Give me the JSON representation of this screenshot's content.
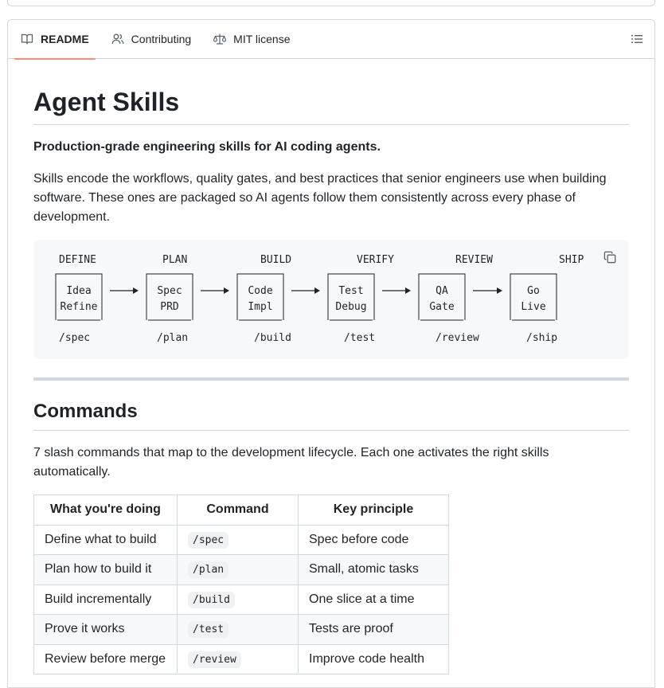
{
  "tabs": [
    {
      "label": "README",
      "icon": "book-icon",
      "active": true
    },
    {
      "label": "Contributing",
      "icon": "people-icon",
      "active": false
    },
    {
      "label": "MIT license",
      "icon": "law-icon",
      "active": false
    }
  ],
  "readme": {
    "title": "Agent Skills",
    "tagline": "Production-grade engineering skills for AI coding agents.",
    "intro": "Skills encode the workflows, quality gates, and best practices that senior engineers use when building software. These ones are packaged so AI agents follow them consistently across every phase of development.",
    "diagram": {
      "phases": [
        "DEFINE",
        "PLAN",
        "BUILD",
        "VERIFY",
        "REVIEW",
        "SHIP"
      ],
      "boxes": [
        {
          "line1": "Idea",
          "line2": "Refine"
        },
        {
          "line1": "Spec",
          "line2": "PRD"
        },
        {
          "line1": "Code",
          "line2": "Impl"
        },
        {
          "line1": "Test",
          "line2": "Debug"
        },
        {
          "line1": "QA",
          "line2": "Gate"
        },
        {
          "line1": "Go",
          "line2": "Live"
        }
      ],
      "commands": [
        "/spec",
        "/plan",
        "/build",
        "/test",
        "/review",
        "/ship"
      ]
    },
    "commands_heading": "Commands",
    "commands_intro": "7 slash commands that map to the development lifecycle. Each one activates the right skills automatically.",
    "table": {
      "headers": [
        "What you're doing",
        "Command",
        "Key principle"
      ],
      "rows": [
        [
          "Define what to build",
          "/spec",
          "Spec before code"
        ],
        [
          "Plan how to build it",
          "/plan",
          "Small, atomic tasks"
        ],
        [
          "Build incrementally",
          "/build",
          "One slice at a time"
        ],
        [
          "Prove it works",
          "/test",
          "Tests are proof"
        ],
        [
          "Review before merge",
          "/review",
          "Improve code health"
        ]
      ]
    }
  },
  "colors": {
    "active_tab_underline": "#fd8c73",
    "border": "#d1d9e0",
    "code_bg": "#f6f8fa"
  }
}
